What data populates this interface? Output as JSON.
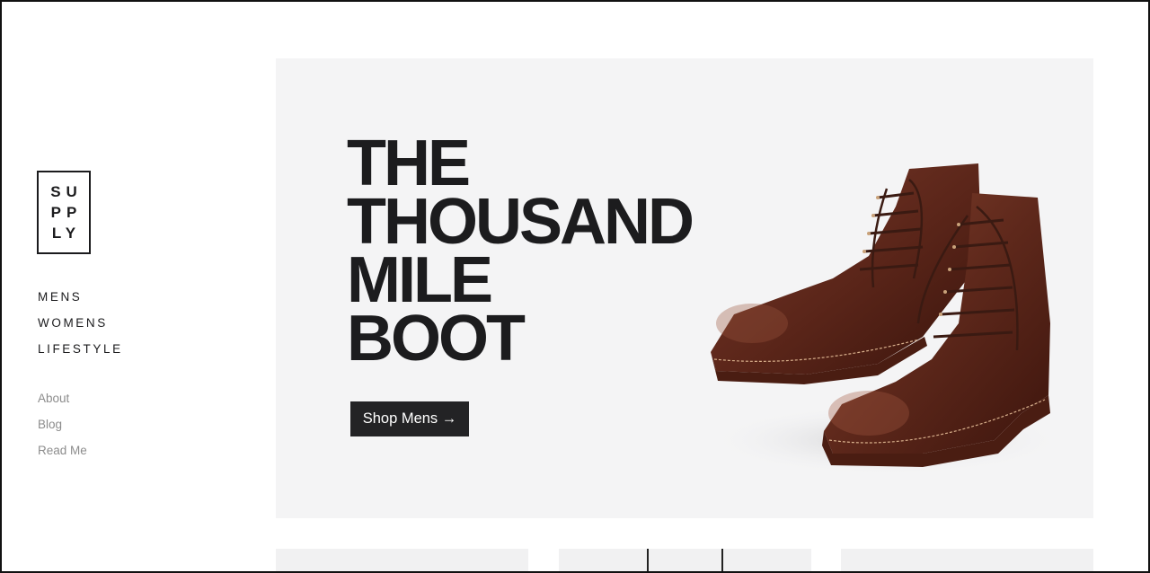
{
  "brand": {
    "logo_lines": [
      "SU",
      "PP",
      "LY"
    ]
  },
  "primary_nav": {
    "items": [
      {
        "label": "MENS"
      },
      {
        "label": "WOMENS"
      },
      {
        "label": "LIFESTYLE"
      }
    ]
  },
  "secondary_nav": {
    "items": [
      {
        "label": "About"
      },
      {
        "label": "Blog"
      },
      {
        "label": "Read Me"
      }
    ]
  },
  "hero": {
    "title_lines": [
      "THE",
      "THOUSAND",
      "MILE",
      "BOOT"
    ],
    "cta_label": "Shop Mens →",
    "background": "#f4f4f5",
    "image": "leather-boots"
  },
  "colors": {
    "text_dark": "#1b1b1d",
    "muted": "#8c8c8c",
    "button": "#232325",
    "boot_leather": "#5e2a1f"
  }
}
